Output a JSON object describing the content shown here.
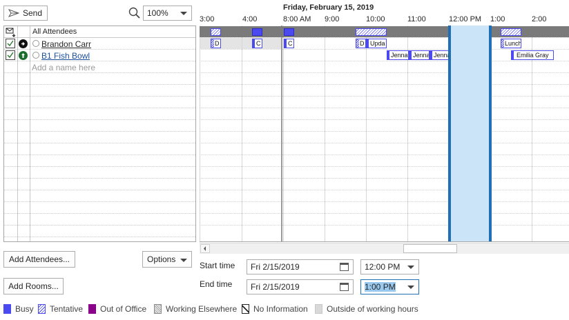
{
  "toolbar": {
    "send_label": "Send",
    "zoom_value": "100%"
  },
  "attendees": {
    "header": "All Attendees",
    "rows": [
      {
        "name": "Brandon Carr",
        "type": "required"
      },
      {
        "name": "B1 Fish Bowl",
        "type": "resource"
      }
    ],
    "add_placeholder": "Add a name here"
  },
  "grid": {
    "date_label": "Friday, February 15, 2019",
    "time_labels": [
      "3:00",
      "4:00",
      "8:00 AM",
      "9:00",
      "10:00",
      "11:00",
      "12:00 PM",
      "1:00",
      "2:00"
    ],
    "appointments": [
      {
        "label": "D",
        "row": "brandon",
        "kind": "tentative"
      },
      {
        "label": "C",
        "row": "brandon",
        "kind": "busy"
      },
      {
        "label": "C",
        "row": "brandon",
        "kind": "busy"
      },
      {
        "label": "D",
        "row": "brandon",
        "kind": "tentative"
      },
      {
        "label": "Upda",
        "row": "brandon",
        "kind": "busy"
      },
      {
        "label": "Lunch",
        "row": "brandon",
        "kind": "tentative"
      },
      {
        "label": "Jenna",
        "row": "fishbowl",
        "kind": "busy"
      },
      {
        "label": "Jenna",
        "row": "fishbowl",
        "kind": "busy"
      },
      {
        "label": "Jenna",
        "row": "fishbowl",
        "kind": "busy"
      },
      {
        "label": "Emilia Gray",
        "row": "fishbowl",
        "kind": "busy"
      }
    ]
  },
  "buttons": {
    "add_attendees": "Add Attendees...",
    "options": "Options",
    "add_rooms": "Add Rooms..."
  },
  "times": {
    "start_label": "Start time",
    "end_label": "End time",
    "start_date": "Fri 2/15/2019",
    "start_time": "12:00 PM",
    "end_date": "Fri 2/15/2019",
    "end_time": "1:00 PM"
  },
  "legend": {
    "busy": "Busy",
    "tentative": "Tentative",
    "out_of_office": "Out of Office",
    "working_elsewhere": "Working Elsewhere",
    "no_information": "No Information",
    "outside_hours": "Outside of working hours"
  },
  "colors": {
    "busy": "#4a4af0",
    "out_of_office": "#8b008b",
    "selection": "#cce4f7",
    "selection_border": "#1e6fb5"
  }
}
